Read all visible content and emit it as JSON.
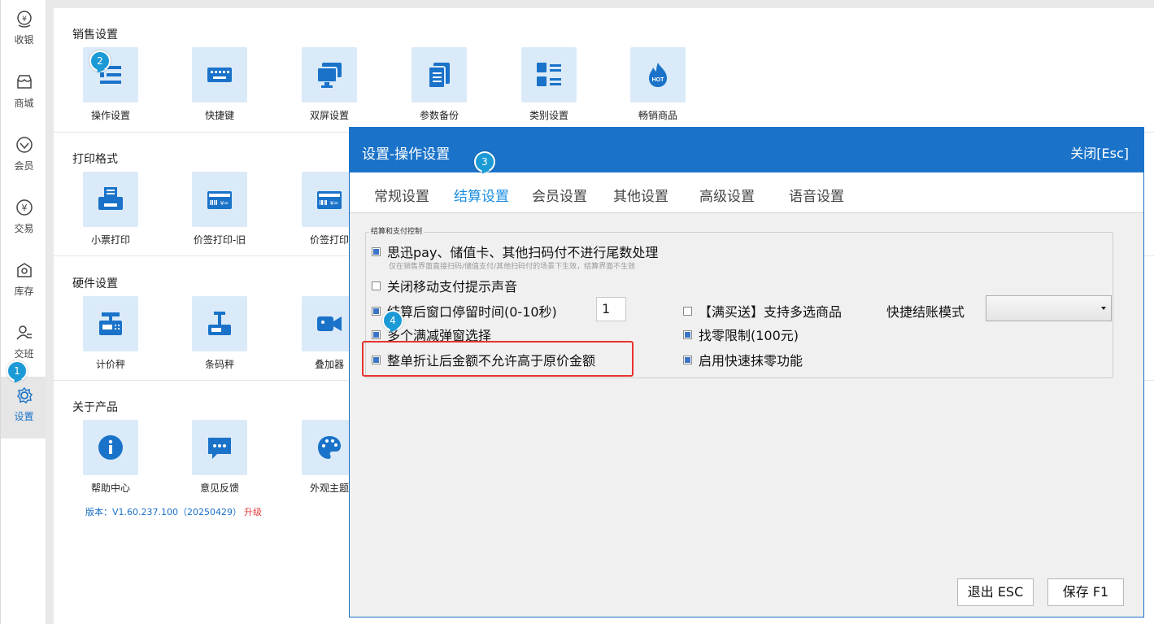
{
  "sidebar": {
    "items": [
      {
        "label": "收银",
        "icon": "cashier-icon"
      },
      {
        "label": "商城",
        "icon": "store-icon"
      },
      {
        "label": "会员",
        "icon": "member-icon"
      },
      {
        "label": "交易",
        "icon": "yen-icon"
      },
      {
        "label": "库存",
        "icon": "inventory-icon"
      },
      {
        "label": "交班",
        "icon": "handover-icon"
      },
      {
        "label": "设置",
        "icon": "gear-icon",
        "active": true
      }
    ]
  },
  "main": {
    "sections": [
      {
        "title": "销售设置",
        "tiles": [
          "操作设置",
          "快捷键",
          "双屏设置",
          "参数备份",
          "类别设置",
          "畅销商品"
        ]
      },
      {
        "title": "打印格式",
        "tiles": [
          "小票打印",
          "价签打印-旧",
          "价签打印"
        ]
      },
      {
        "title": "硬件设置",
        "tiles": [
          "计价秤",
          "条码秤",
          "叠加器"
        ]
      },
      {
        "title": "关于产品",
        "tiles": [
          "帮助中心",
          "意见反馈",
          "外观主题"
        ]
      }
    ],
    "version": "版本：V1.60.237.100（20250429）",
    "upgrade": "升级"
  },
  "badges": [
    "1",
    "2",
    "3",
    "4"
  ],
  "dialog": {
    "title": "设置-操作设置",
    "close": "关闭[Esc]",
    "tabs": [
      "常规设置",
      "结算设置",
      "会员设置",
      "其他设置",
      "高级设置",
      "语音设置"
    ],
    "active_tab": "结算设置",
    "group_label": "结算和支付控制",
    "hint": "仅在销售界面直接扫码/储值支付/其他扫码付的场景下生效，结算界面不生效",
    "options": {
      "no_rounding": {
        "label": "思迅pay、储值卡、其他扫码付不进行尾数处理",
        "checked": true
      },
      "mute_mobile_pay": {
        "label": "关闭移动支付提示声音",
        "checked": false
      },
      "stay_time": {
        "label": "结算后窗口停留时间(0-10秒)",
        "checked": true,
        "value": "1"
      },
      "multi_discount": {
        "label": "多个满减弹窗选择",
        "checked": true
      },
      "no_exceed_price": {
        "label": "整单折让后金额不允许高于原价金额",
        "checked": true
      },
      "buy_gift_multi": {
        "label": "【满买送】支持多选商品",
        "checked": false
      },
      "change_limit": {
        "label": "找零限制(100元)",
        "checked": true
      },
      "quick_round": {
        "label": "启用快速抹零功能",
        "checked": true
      }
    },
    "quick_checkout_label": "快捷结账模式",
    "quick_checkout_value": "",
    "buttons": {
      "exit": "退出 ESC",
      "save": "保存 F1"
    }
  }
}
